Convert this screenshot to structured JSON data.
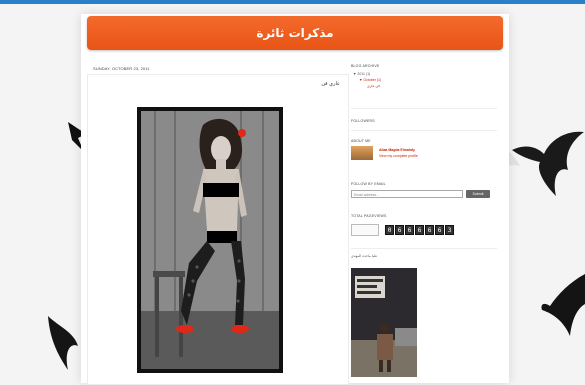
{
  "blog": {
    "title": "مذكرات ثائرة"
  },
  "post": {
    "date": "SUNDAY, OCTOBER 23, 2011",
    "title": "عاري فن"
  },
  "sidebar": {
    "archive_heading": "BLOG ARCHIVE",
    "archive_year": "▼ 2011 (1)",
    "archive_month": "▼ October (1)",
    "archive_post": "فن عاري",
    "followers_heading": "FOLLOWERS",
    "about_heading": "ABOUT ME",
    "about_name": "Aliaa Magda Elmahdy",
    "about_link": "View my complete profile",
    "follow_heading": "FOLLOW BY EMAIL",
    "email_placeholder": "Email address...",
    "submit_label": "Submit",
    "pageviews_heading": "TOTAL PAGEVIEWS",
    "pageviews_digits": [
      "0",
      "6",
      "6",
      "6",
      "6",
      "6",
      "3"
    ],
    "caption": "عليا ماجده المهدي"
  },
  "colors": {
    "header": "#e85416",
    "link": "#cc2200",
    "topbar": "#2a7fc9"
  }
}
